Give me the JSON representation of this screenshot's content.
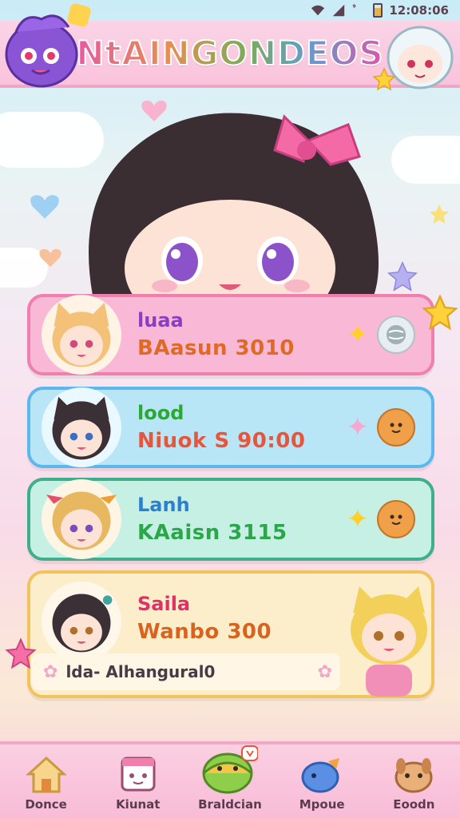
{
  "status_bar": {
    "time": "12:08:06"
  },
  "header": {
    "title": "NtAINGONDEOS"
  },
  "cards": [
    {
      "name": "luaa",
      "subtitle": "BAasun 3010",
      "theme": "pink"
    },
    {
      "name": "lood",
      "subtitle": "Niuok S 90:00",
      "theme": "blue"
    },
    {
      "name": "Lanh",
      "subtitle": "KAaisn 3115",
      "theme": "green"
    },
    {
      "name": "Saila",
      "subtitle": "Wanbo 300",
      "footer_text": "lda- Alhangural0",
      "theme": "yellow"
    }
  ],
  "bottom_nav": [
    {
      "label": "Donce",
      "icon": "house-icon"
    },
    {
      "label": "Kiunat",
      "icon": "calendar-icon"
    },
    {
      "label": "Braldcian",
      "icon": "chat-mascot-icon"
    },
    {
      "label": "Mpoue",
      "icon": "bird-icon"
    },
    {
      "label": "Eoodn",
      "icon": "dog-icon"
    }
  ],
  "colors": {
    "card_pink": "#f9b8d6",
    "card_blue": "#b9e6f7",
    "card_green": "#c6f0e4",
    "card_yellow": "#fdeecb"
  }
}
